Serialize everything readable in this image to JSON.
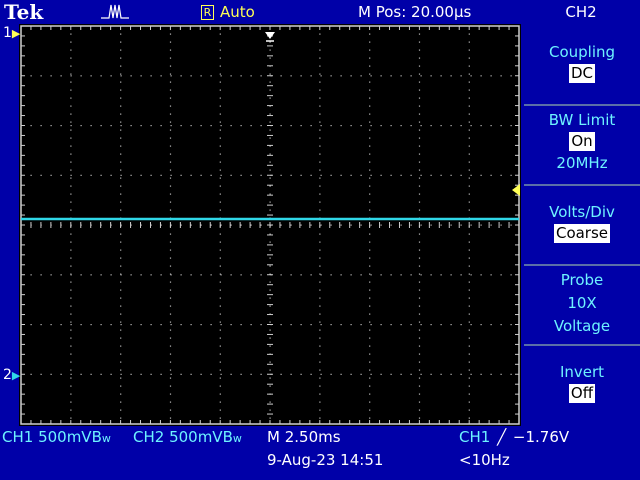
{
  "header": {
    "brand": "Tek",
    "trigger_state_icon": "trigger-waveform-icon",
    "acquisition_badge": "R",
    "acquisition_mode": "Auto",
    "main_position": "M Pos: 20.00µs",
    "menu_channel": "CH2"
  },
  "side_menu": {
    "coupling": {
      "label": "Coupling",
      "value": "DC"
    },
    "bw_limit": {
      "label": "BW Limit",
      "value": "On",
      "sub": "20MHz"
    },
    "volts_div": {
      "label": "Volts/Div",
      "value": "Coarse"
    },
    "probe": {
      "label": "Probe",
      "line2": "10X",
      "line3": "Voltage"
    },
    "invert": {
      "label": "Invert",
      "value": "Off"
    }
  },
  "markers": {
    "ch1": "1",
    "ch2": "2"
  },
  "status_bar": {
    "ch1_scale": "CH1  500mV",
    "ch1_bw": "B",
    "ch1_bw_sub": "w",
    "ch2_scale": "CH2  500mV",
    "ch2_bw": "B",
    "ch2_bw_sub": "w",
    "timebase": "M 2.50ms",
    "trigger_source": "CH1",
    "trigger_slope": "╱",
    "trigger_level": "−1.76V",
    "date": "9-Aug-23 14:51",
    "frequency": "<10Hz"
  },
  "colors": {
    "background": "#0000a8",
    "screen": "#000000",
    "ch1": "#ffff55",
    "ch2": "#30d8e8",
    "menu_text": "#6ef2ff"
  }
}
